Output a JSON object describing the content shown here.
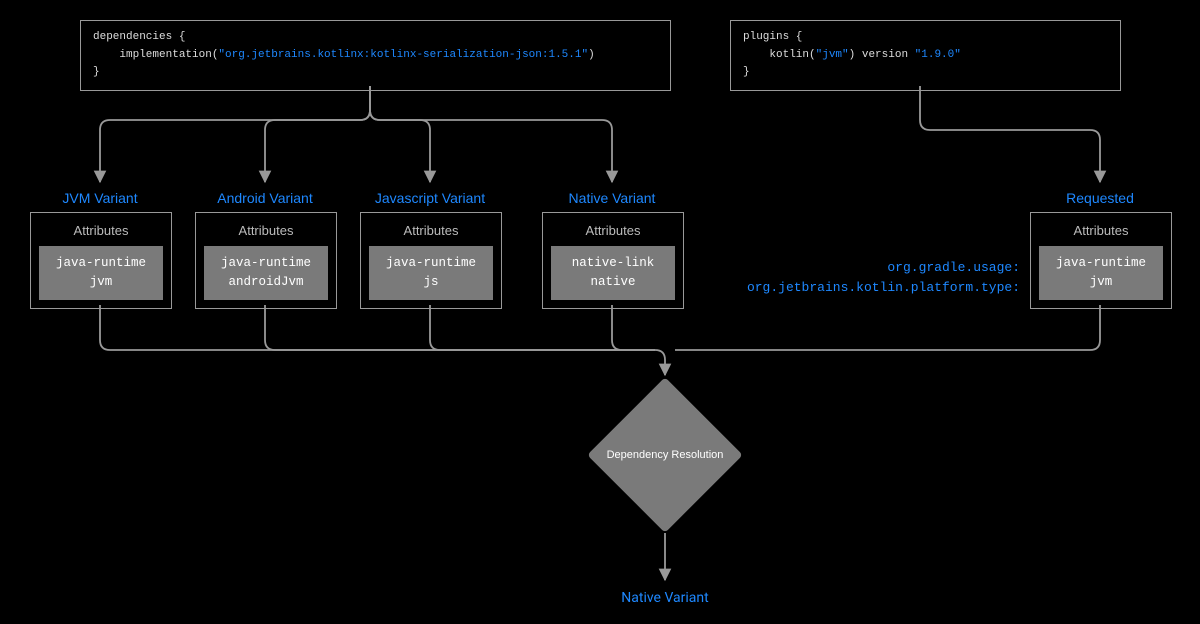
{
  "code_left": {
    "line1_a": "dependencies {",
    "line2_a": "    implementation(",
    "line2_b": "\"org.jetbrains.kotlinx:kotlinx-serialization-json:1.5.1\"",
    "line2_c": ")",
    "line3_a": "}"
  },
  "code_right": {
    "line1_a": "plugins {",
    "line2_a": "    kotlin(",
    "line2_b": "\"jvm\"",
    "line2_c": ") version ",
    "line2_d": "\"1.9.0\"",
    "line3_a": "}"
  },
  "variants": {
    "jvm": {
      "title": "JVM Variant",
      "head": "Attributes",
      "l1": "java-runtime",
      "l2": "jvm"
    },
    "android": {
      "title": "Android Variant",
      "head": "Attributes",
      "l1": "java-runtime",
      "l2": "androidJvm"
    },
    "js": {
      "title": "Javascript Variant",
      "head": "Attributes",
      "l1": "java-runtime",
      "l2": "js"
    },
    "native": {
      "title": "Native Variant",
      "head": "Attributes",
      "l1": "native-link",
      "l2": "native"
    },
    "requested": {
      "title": "Requested",
      "head": "Attributes",
      "l1": "java-runtime",
      "l2": "jvm"
    }
  },
  "attr_labels": {
    "l1": "org.gradle.usage:",
    "l2": "org.jetbrains.kotlin.platform.type:"
  },
  "diamond": "Dependency Resolution",
  "result": "Native Variant"
}
